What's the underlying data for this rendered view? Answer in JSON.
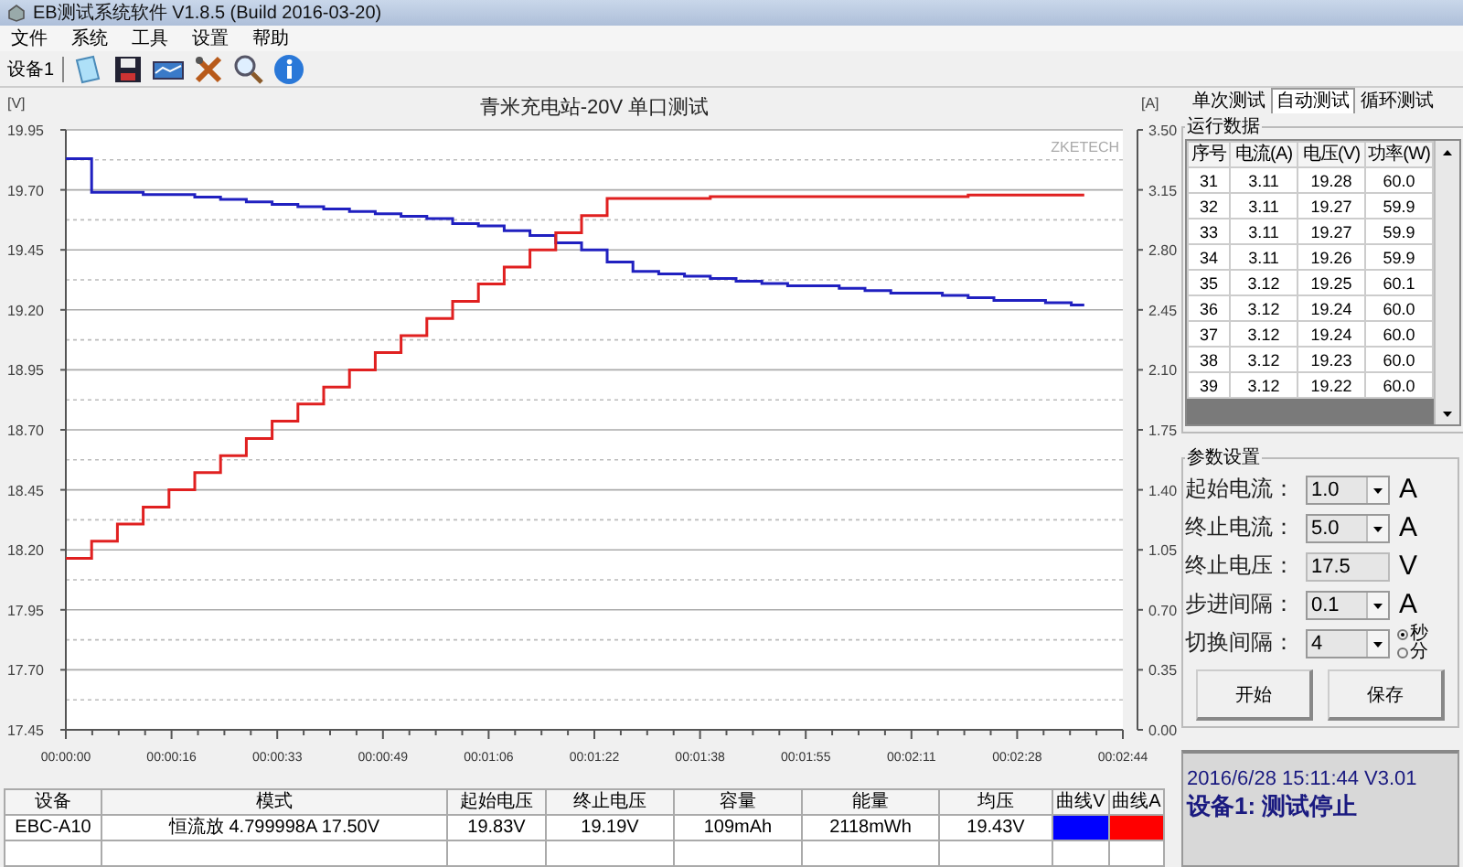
{
  "window": {
    "title": "EB测试系统软件 V1.8.5 (Build 2016-03-20)"
  },
  "menu": [
    "文件",
    "系统",
    "工具",
    "设置",
    "帮助"
  ],
  "toolbar": {
    "device_label": "设备1"
  },
  "chart": {
    "brand_label": "ZKETECH",
    "chart_data": {
      "type": "line",
      "title": "青米充电站-20V 单口测试",
      "ylabel": "[V]",
      "y2label": "[A]",
      "grid": true,
      "x": [
        0,
        4,
        4,
        8,
        8,
        12,
        12,
        16,
        16,
        20,
        20,
        24,
        24,
        28,
        28,
        32,
        32,
        36,
        36,
        40,
        40,
        44,
        44,
        48,
        48,
        52,
        52,
        56,
        56,
        60,
        60,
        64,
        64,
        68,
        68,
        72,
        72,
        76,
        76,
        80,
        80,
        84,
        84,
        88,
        88,
        92,
        92,
        96,
        96,
        100,
        100,
        104,
        104,
        108,
        108,
        112,
        112,
        116,
        116,
        120,
        120,
        124,
        124,
        128,
        128,
        132,
        132,
        136,
        136,
        140,
        140,
        144,
        144,
        148,
        148,
        152,
        152,
        156,
        156,
        158
      ],
      "xlim": [
        0,
        164
      ],
      "xticks": [
        {
          "value": 0,
          "label": "00:00:00"
        },
        {
          "value": 16.4,
          "label": "00:00:16"
        },
        {
          "value": 32.8,
          "label": "00:00:33"
        },
        {
          "value": 49.2,
          "label": "00:00:49"
        },
        {
          "value": 65.6,
          "label": "00:01:06"
        },
        {
          "value": 82,
          "label": "00:01:22"
        },
        {
          "value": 98.4,
          "label": "00:01:38"
        },
        {
          "value": 114.8,
          "label": "00:01:55"
        },
        {
          "value": 131.2,
          "label": "00:02:11"
        },
        {
          "value": 147.6,
          "label": "00:02:28"
        },
        {
          "value": 164,
          "label": "00:02:44"
        }
      ],
      "ylim": [
        17.45,
        19.95
      ],
      "yticks": [
        {
          "value": 19.95,
          "label": "19.95"
        },
        {
          "value": 19.7,
          "label": "19.70"
        },
        {
          "value": 19.45,
          "label": "19.45"
        },
        {
          "value": 19.2,
          "label": "19.20"
        },
        {
          "value": 18.95,
          "label": "18.95"
        },
        {
          "value": 18.7,
          "label": "18.70"
        },
        {
          "value": 18.45,
          "label": "18.45"
        },
        {
          "value": 18.2,
          "label": "18.20"
        },
        {
          "value": 17.95,
          "label": "17.95"
        },
        {
          "value": 17.7,
          "label": "17.70"
        },
        {
          "value": 17.45,
          "label": "17.45"
        }
      ],
      "y2lim": [
        0,
        3.5
      ],
      "y2ticks": [
        {
          "value": 3.5,
          "label": "3.50"
        },
        {
          "value": 3.15,
          "label": "3.15"
        },
        {
          "value": 2.8,
          "label": "2.80"
        },
        {
          "value": 2.45,
          "label": "2.45"
        },
        {
          "value": 2.1,
          "label": "2.10"
        },
        {
          "value": 1.75,
          "label": "1.75"
        },
        {
          "value": 1.4,
          "label": "1.40"
        },
        {
          "value": 1.05,
          "label": "1.05"
        },
        {
          "value": 0.7,
          "label": "0.70"
        },
        {
          "value": 0.35,
          "label": "0.35"
        },
        {
          "value": 0,
          "label": "0.00"
        }
      ],
      "series": [
        {
          "color": "#2020c0",
          "values": [
            19.83,
            19.83,
            19.69,
            19.69,
            19.69,
            19.69,
            19.68,
            19.68,
            19.68,
            19.68,
            19.67,
            19.67,
            19.66,
            19.66,
            19.65,
            19.65,
            19.64,
            19.64,
            19.63,
            19.63,
            19.62,
            19.62,
            19.61,
            19.61,
            19.6,
            19.6,
            19.59,
            19.59,
            19.58,
            19.58,
            19.56,
            19.56,
            19.55,
            19.55,
            19.53,
            19.53,
            19.51,
            19.51,
            19.48,
            19.48,
            19.45,
            19.45,
            19.4,
            19.4,
            19.36,
            19.36,
            19.35,
            19.35,
            19.34,
            19.34,
            19.33,
            19.33,
            19.32,
            19.32,
            19.31,
            19.31,
            19.3,
            19.3,
            19.3,
            19.3,
            19.29,
            19.29,
            19.28,
            19.28,
            19.27,
            19.27,
            19.27,
            19.27,
            19.26,
            19.26,
            19.25,
            19.25,
            19.24,
            19.24,
            19.24,
            19.24,
            19.23,
            19.23,
            19.22,
            19.22
          ]
        },
        {
          "color": "#e02020",
          "axis": "y2",
          "values": [
            1.0,
            1.0,
            1.1,
            1.1,
            1.2,
            1.2,
            1.3,
            1.3,
            1.4,
            1.4,
            1.5,
            1.5,
            1.6,
            1.6,
            1.7,
            1.7,
            1.8,
            1.8,
            1.9,
            1.9,
            2.0,
            2.0,
            2.1,
            2.1,
            2.2,
            2.2,
            2.3,
            2.3,
            2.4,
            2.4,
            2.5,
            2.5,
            2.6,
            2.6,
            2.7,
            2.7,
            2.8,
            2.8,
            2.9,
            2.9,
            3.0,
            3.0,
            3.1,
            3.1,
            3.1,
            3.1,
            3.1,
            3.1,
            3.1,
            3.1,
            3.11,
            3.11,
            3.11,
            3.11,
            3.11,
            3.11,
            3.11,
            3.11,
            3.11,
            3.11,
            3.11,
            3.11,
            3.11,
            3.11,
            3.11,
            3.11,
            3.11,
            3.11,
            3.11,
            3.11,
            3.12,
            3.12,
            3.12,
            3.12,
            3.12,
            3.12,
            3.12,
            3.12,
            3.12,
            3.12
          ]
        }
      ]
    }
  },
  "summary": {
    "columns": [
      "设备",
      "模式",
      "起始电压",
      "终止电压",
      "容量",
      "能量",
      "均压",
      "曲线V",
      "曲线A"
    ],
    "rows": [
      {
        "cells": [
          "EBC-A10",
          "恒流放 4.799998A 17.50V",
          "19.83V",
          "19.19V",
          "109mAh",
          "2118mWh",
          "19.43V"
        ],
        "swatches": [
          {
            "color": "#0000ff"
          },
          {
            "color": "#ff0000"
          }
        ]
      }
    ]
  },
  "tabs": [
    {
      "label": "单次测试",
      "selected": false
    },
    {
      "label": "自动测试",
      "selected": true
    },
    {
      "label": "循环测试",
      "selected": false
    }
  ],
  "run_data": {
    "title": "运行数据",
    "columns": [
      "序号",
      "电流(A)",
      "电压(V)",
      "功率(W)"
    ],
    "rows": [
      [
        "31",
        "3.11",
        "19.28",
        "60.0"
      ],
      [
        "32",
        "3.11",
        "19.27",
        "59.9"
      ],
      [
        "33",
        "3.11",
        "19.27",
        "59.9"
      ],
      [
        "34",
        "3.11",
        "19.26",
        "59.9"
      ],
      [
        "35",
        "3.12",
        "19.25",
        "60.1"
      ],
      [
        "36",
        "3.12",
        "19.24",
        "60.0"
      ],
      [
        "37",
        "3.12",
        "19.24",
        "60.0"
      ],
      [
        "38",
        "3.12",
        "19.23",
        "60.0"
      ],
      [
        "39",
        "3.12",
        "19.22",
        "60.0"
      ]
    ]
  },
  "params": {
    "title": "参数设置",
    "fields": [
      {
        "kind": "combo",
        "label": "起始电流：",
        "value": "1.0",
        "unit": "A"
      },
      {
        "kind": "combo",
        "label": "终止电流：",
        "value": "5.0",
        "unit": "A"
      },
      {
        "kind": "text",
        "label": "终止电压：",
        "value": "17.5",
        "unit": "V"
      },
      {
        "kind": "combo",
        "label": "步进间隔：",
        "value": "0.1",
        "unit": "A"
      },
      {
        "kind": "combo",
        "label": "切换间隔：",
        "value": "4",
        "options": [
          {
            "label": "秒",
            "selected": true
          },
          {
            "label": "分",
            "selected": false
          }
        ]
      }
    ],
    "buttons": [
      "开始",
      "保存"
    ]
  },
  "status": {
    "line": "2016/6/28 15:11:44  V3.01",
    "message": "设备1: 测试停止"
  }
}
